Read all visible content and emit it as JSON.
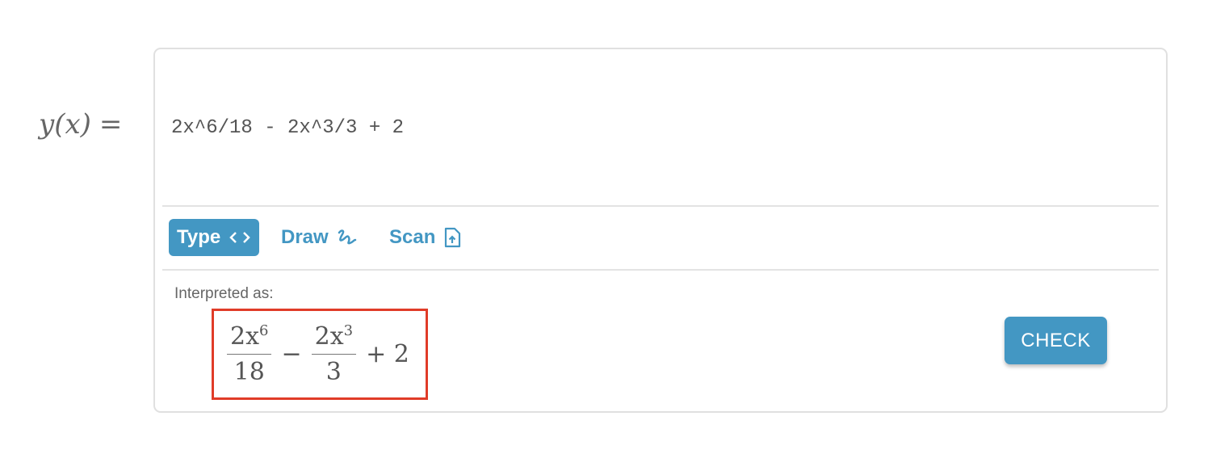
{
  "label": {
    "func": "y(x)",
    "eq": "="
  },
  "input": {
    "value": "2x^6/18 - 2x^3/3 + 2"
  },
  "tabs": [
    {
      "label": "Type",
      "icon": "code-icon",
      "active": true
    },
    {
      "label": "Draw",
      "icon": "scribble-icon"
    },
    {
      "label": "Scan",
      "icon": "file-upload-icon"
    }
  ],
  "interpreted": {
    "label": "Interpreted as:",
    "t1": {
      "num": "2x",
      "exp": "6",
      "den": "18"
    },
    "op1": "−",
    "t2": {
      "num": "2x",
      "exp": "3",
      "den": "3"
    },
    "rest": "+ 2"
  },
  "check_label": "CHECK",
  "colors": {
    "accent": "#4397c3",
    "highlight": "#e03c28"
  }
}
